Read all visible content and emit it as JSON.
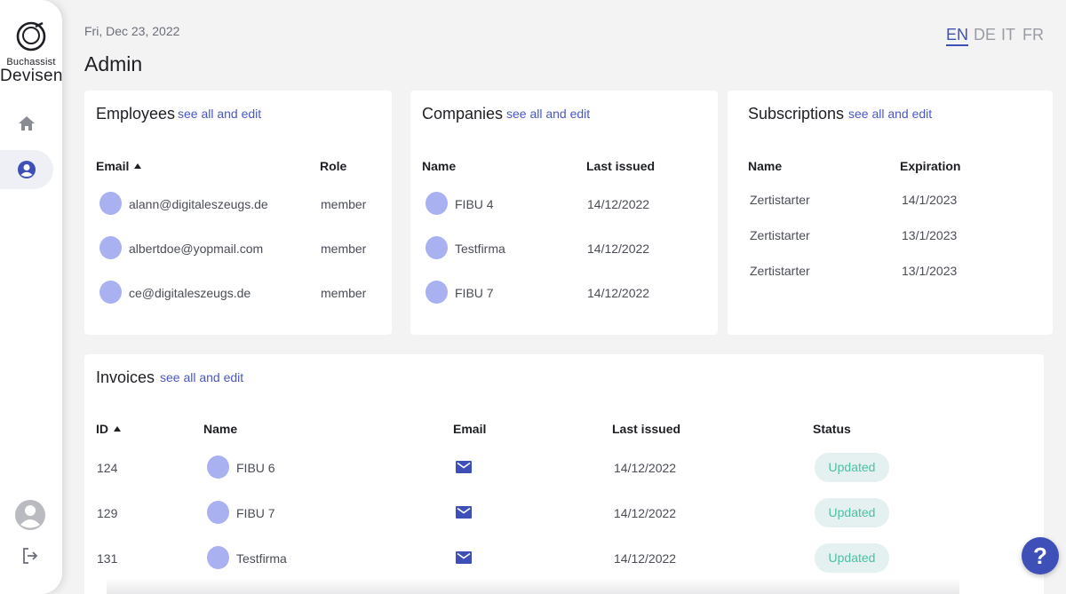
{
  "sidebar": {
    "logo_top": "Buchassist",
    "logo_bottom": "Devisen",
    "items": [
      {
        "icon": "home-icon"
      },
      {
        "icon": "user-circle-icon"
      }
    ]
  },
  "header": {
    "date": "Fri, Dec 23, 2022",
    "title": "Admin",
    "languages": [
      "EN",
      "DE",
      "IT",
      "FR"
    ],
    "active_language": "EN"
  },
  "employees": {
    "title": "Employees",
    "link": "see all and edit",
    "columns": [
      "Email",
      "Role"
    ],
    "rows": [
      {
        "email": "alann@digitaleszeugs.de",
        "role": "member"
      },
      {
        "email": "albertdoe@yopmail.com",
        "role": "member"
      },
      {
        "email": "ce@digitaleszeugs.de",
        "role": "member"
      }
    ]
  },
  "companies": {
    "title": "Companies",
    "link": "see all and edit",
    "columns": [
      "Name",
      "Last issued"
    ],
    "rows": [
      {
        "name": "FIBU 4",
        "last_issued": "14/12/2022"
      },
      {
        "name": "Testfirma",
        "last_issued": "14/12/2022"
      },
      {
        "name": "FIBU 7",
        "last_issued": "14/12/2022"
      }
    ]
  },
  "subscriptions": {
    "title": "Subscriptions",
    "link": "see all and edit",
    "columns": [
      "Name",
      "Expiration"
    ],
    "rows": [
      {
        "name": "Zertistarter",
        "expiration": "14/1/2023"
      },
      {
        "name": "Zertistarter",
        "expiration": "13/1/2023"
      },
      {
        "name": "Zertistarter",
        "expiration": "13/1/2023"
      }
    ]
  },
  "invoices": {
    "title": "Invoices",
    "link": "see all and edit",
    "columns": [
      "ID",
      "Name",
      "Email",
      "Last issued",
      "Status"
    ],
    "rows": [
      {
        "id": "124",
        "name": "FIBU 6",
        "last_issued": "14/12/2022",
        "status": "Updated"
      },
      {
        "id": "129",
        "name": "FIBU 7",
        "last_issued": "14/12/2022",
        "status": "Updated"
      },
      {
        "id": "131",
        "name": "Testfirma",
        "last_issued": "14/12/2022",
        "status": "Updated"
      }
    ]
  },
  "help": {
    "label": "?"
  },
  "colors": {
    "accent": "#3e4fb8",
    "link": "#4a57c5",
    "avatar_dot": "#a9b1f0",
    "status_bg": "#e4f1f0",
    "status_text": "#4dbfa6",
    "background": "#f3f3f4"
  }
}
